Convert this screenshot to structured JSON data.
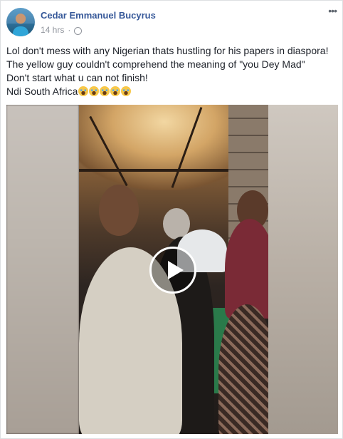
{
  "post": {
    "author": "Cedar Emmanuel Bucyrus",
    "timestamp": "14 hrs",
    "separator": "·",
    "privacy_icon": "globe-icon",
    "more_icon": "more-options-icon",
    "more_label": "•••",
    "text_lines": [
      "Lol don't mess with any Nigerian thats hustling for his papers in diaspora!",
      "The yellow guy couldn't comprehend the meaning of \"you Dey Mad\"",
      "Don't start what u can not finish!",
      "Ndi South Africa"
    ],
    "emoji_count": 5,
    "emoji": "tears-of-joy-emoji"
  },
  "video": {
    "play_icon": "play-icon"
  },
  "colors": {
    "author_link": "#365899",
    "meta": "#90949c",
    "text": "#1d2129"
  }
}
